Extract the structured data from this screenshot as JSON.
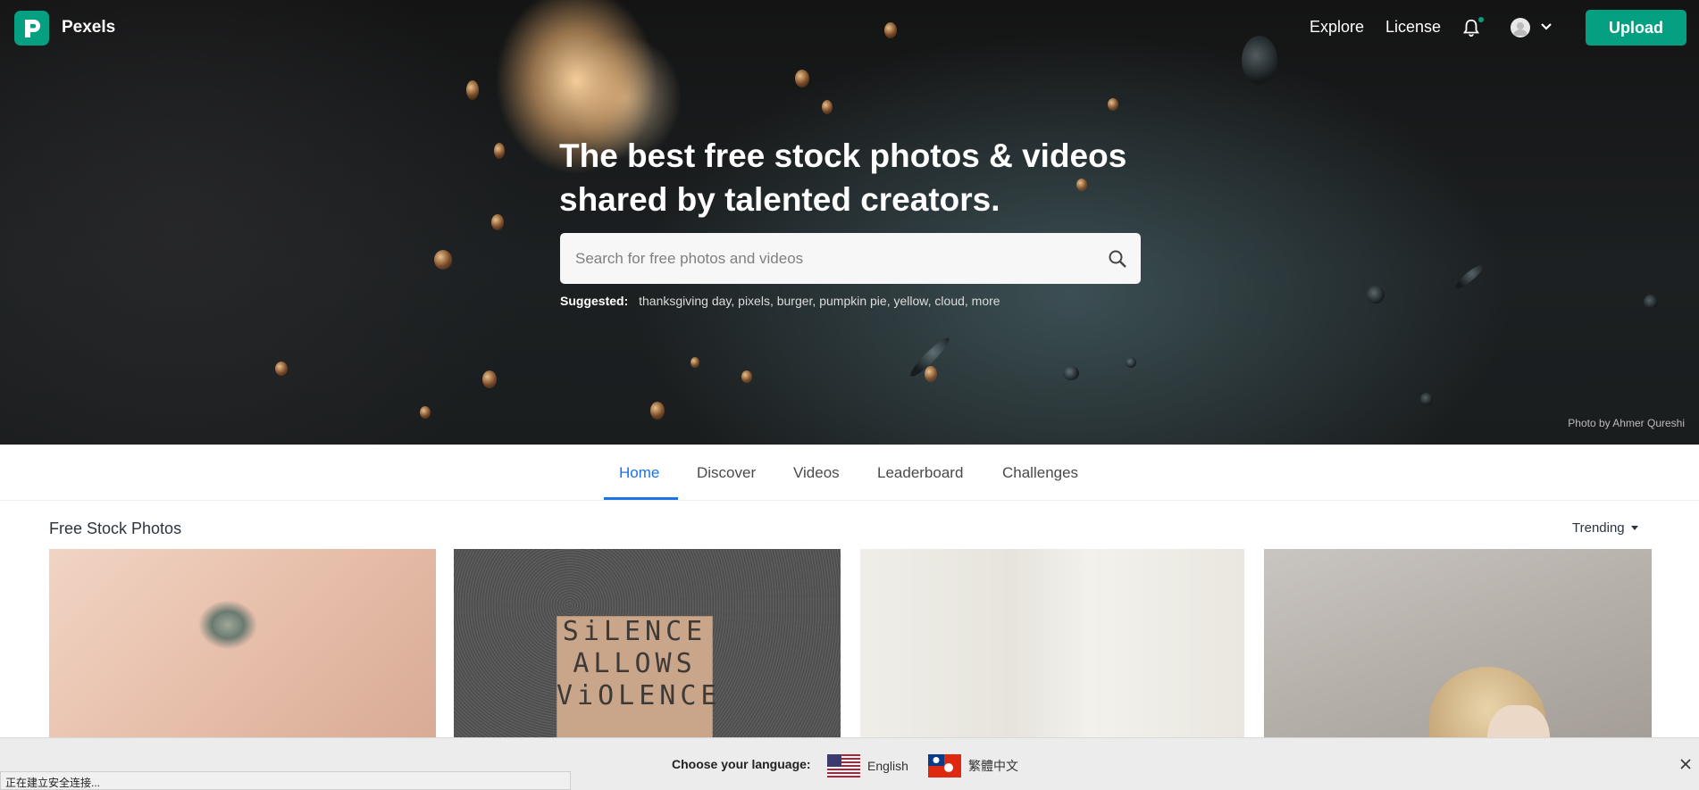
{
  "brand": {
    "name": "Pexels",
    "accent": "#05a081"
  },
  "nav": {
    "explore": "Explore",
    "license": "License",
    "upload": "Upload",
    "icons": [
      "bell-icon",
      "avatar",
      "chevron-down-icon"
    ]
  },
  "hero": {
    "title": "The best free stock photos & videos shared by talented creators.",
    "search_placeholder": "Search for free photos and videos",
    "suggested_label": "Suggested:",
    "suggested_tags": [
      "thanksgiving day,",
      "pixels,",
      "burger,",
      "pumpkin pie,",
      "yellow,",
      "cloud,",
      "more"
    ],
    "credit": "Photo by Ahmer Qureshi"
  },
  "tabs": [
    {
      "label": "Home",
      "active": true
    },
    {
      "label": "Discover",
      "active": false
    },
    {
      "label": "Videos",
      "active": false
    },
    {
      "label": "Leaderboard",
      "active": false
    },
    {
      "label": "Challenges",
      "active": false
    }
  ],
  "section": {
    "title": "Free Stock Photos",
    "sort": "Trending"
  },
  "photos": [
    {
      "subject": "close-up eye"
    },
    {
      "subject": "cardboard sign",
      "sign_text": [
        "SiLENCE",
        "ALLOWS",
        "ViOLENCE"
      ]
    },
    {
      "subject": "white fabric"
    },
    {
      "subject": "blonde woman"
    }
  ],
  "language_bar": {
    "label": "Choose your language:",
    "options": [
      {
        "label": "English",
        "flag": "us-flag-icon"
      },
      {
        "label": "繁體中文",
        "flag": "hk-flag-icon"
      }
    ]
  },
  "status_bar": "正在建立安全连接..."
}
